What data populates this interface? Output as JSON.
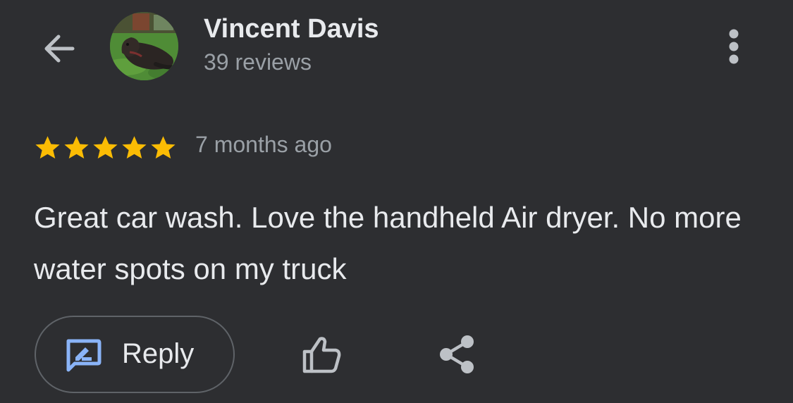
{
  "header": {
    "back_icon": "arrow-left-icon",
    "user_name": "Vincent Davis",
    "review_count": "39 reviews",
    "avatar": "dog-on-grass-photo",
    "more_icon": "more-vertical-icon"
  },
  "review": {
    "rating": 5,
    "max_rating": 5,
    "timestamp": "7 months ago",
    "text": "Great car wash. Love the handheld Air dryer. No more water spots on my truck"
  },
  "actions": {
    "reply_label": "Reply",
    "reply_icon": "rate-review-icon",
    "like_icon": "thumb-up-icon",
    "share_icon": "share-icon"
  },
  "colors": {
    "background": "#2d2e31",
    "text_primary": "#e8eaed",
    "text_secondary": "#9aa0a6",
    "star": "#fbbc04",
    "accent_blue": "#8ab4f8",
    "outline": "#5f6368"
  }
}
